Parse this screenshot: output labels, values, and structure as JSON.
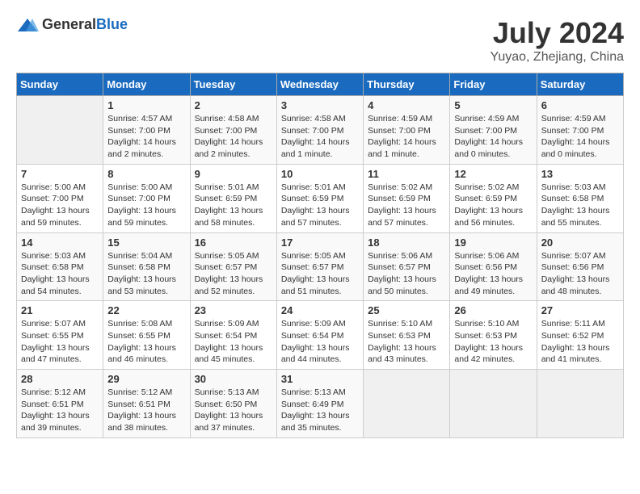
{
  "header": {
    "logo_general": "General",
    "logo_blue": "Blue",
    "title": "July 2024",
    "subtitle": "Yuyao, Zhejiang, China"
  },
  "calendar": {
    "columns": [
      "Sunday",
      "Monday",
      "Tuesday",
      "Wednesday",
      "Thursday",
      "Friday",
      "Saturday"
    ],
    "weeks": [
      [
        {
          "day": "",
          "info": ""
        },
        {
          "day": "1",
          "info": "Sunrise: 4:57 AM\nSunset: 7:00 PM\nDaylight: 14 hours\nand 2 minutes."
        },
        {
          "day": "2",
          "info": "Sunrise: 4:58 AM\nSunset: 7:00 PM\nDaylight: 14 hours\nand 2 minutes."
        },
        {
          "day": "3",
          "info": "Sunrise: 4:58 AM\nSunset: 7:00 PM\nDaylight: 14 hours\nand 1 minute."
        },
        {
          "day": "4",
          "info": "Sunrise: 4:59 AM\nSunset: 7:00 PM\nDaylight: 14 hours\nand 1 minute."
        },
        {
          "day": "5",
          "info": "Sunrise: 4:59 AM\nSunset: 7:00 PM\nDaylight: 14 hours\nand 0 minutes."
        },
        {
          "day": "6",
          "info": "Sunrise: 4:59 AM\nSunset: 7:00 PM\nDaylight: 14 hours\nand 0 minutes."
        }
      ],
      [
        {
          "day": "7",
          "info": "Sunrise: 5:00 AM\nSunset: 7:00 PM\nDaylight: 13 hours\nand 59 minutes."
        },
        {
          "day": "8",
          "info": "Sunrise: 5:00 AM\nSunset: 7:00 PM\nDaylight: 13 hours\nand 59 minutes."
        },
        {
          "day": "9",
          "info": "Sunrise: 5:01 AM\nSunset: 6:59 PM\nDaylight: 13 hours\nand 58 minutes."
        },
        {
          "day": "10",
          "info": "Sunrise: 5:01 AM\nSunset: 6:59 PM\nDaylight: 13 hours\nand 57 minutes."
        },
        {
          "day": "11",
          "info": "Sunrise: 5:02 AM\nSunset: 6:59 PM\nDaylight: 13 hours\nand 57 minutes."
        },
        {
          "day": "12",
          "info": "Sunrise: 5:02 AM\nSunset: 6:59 PM\nDaylight: 13 hours\nand 56 minutes."
        },
        {
          "day": "13",
          "info": "Sunrise: 5:03 AM\nSunset: 6:58 PM\nDaylight: 13 hours\nand 55 minutes."
        }
      ],
      [
        {
          "day": "14",
          "info": "Sunrise: 5:03 AM\nSunset: 6:58 PM\nDaylight: 13 hours\nand 54 minutes."
        },
        {
          "day": "15",
          "info": "Sunrise: 5:04 AM\nSunset: 6:58 PM\nDaylight: 13 hours\nand 53 minutes."
        },
        {
          "day": "16",
          "info": "Sunrise: 5:05 AM\nSunset: 6:57 PM\nDaylight: 13 hours\nand 52 minutes."
        },
        {
          "day": "17",
          "info": "Sunrise: 5:05 AM\nSunset: 6:57 PM\nDaylight: 13 hours\nand 51 minutes."
        },
        {
          "day": "18",
          "info": "Sunrise: 5:06 AM\nSunset: 6:57 PM\nDaylight: 13 hours\nand 50 minutes."
        },
        {
          "day": "19",
          "info": "Sunrise: 5:06 AM\nSunset: 6:56 PM\nDaylight: 13 hours\nand 49 minutes."
        },
        {
          "day": "20",
          "info": "Sunrise: 5:07 AM\nSunset: 6:56 PM\nDaylight: 13 hours\nand 48 minutes."
        }
      ],
      [
        {
          "day": "21",
          "info": "Sunrise: 5:07 AM\nSunset: 6:55 PM\nDaylight: 13 hours\nand 47 minutes."
        },
        {
          "day": "22",
          "info": "Sunrise: 5:08 AM\nSunset: 6:55 PM\nDaylight: 13 hours\nand 46 minutes."
        },
        {
          "day": "23",
          "info": "Sunrise: 5:09 AM\nSunset: 6:54 PM\nDaylight: 13 hours\nand 45 minutes."
        },
        {
          "day": "24",
          "info": "Sunrise: 5:09 AM\nSunset: 6:54 PM\nDaylight: 13 hours\nand 44 minutes."
        },
        {
          "day": "25",
          "info": "Sunrise: 5:10 AM\nSunset: 6:53 PM\nDaylight: 13 hours\nand 43 minutes."
        },
        {
          "day": "26",
          "info": "Sunrise: 5:10 AM\nSunset: 6:53 PM\nDaylight: 13 hours\nand 42 minutes."
        },
        {
          "day": "27",
          "info": "Sunrise: 5:11 AM\nSunset: 6:52 PM\nDaylight: 13 hours\nand 41 minutes."
        }
      ],
      [
        {
          "day": "28",
          "info": "Sunrise: 5:12 AM\nSunset: 6:51 PM\nDaylight: 13 hours\nand 39 minutes."
        },
        {
          "day": "29",
          "info": "Sunrise: 5:12 AM\nSunset: 6:51 PM\nDaylight: 13 hours\nand 38 minutes."
        },
        {
          "day": "30",
          "info": "Sunrise: 5:13 AM\nSunset: 6:50 PM\nDaylight: 13 hours\nand 37 minutes."
        },
        {
          "day": "31",
          "info": "Sunrise: 5:13 AM\nSunset: 6:49 PM\nDaylight: 13 hours\nand 35 minutes."
        },
        {
          "day": "",
          "info": ""
        },
        {
          "day": "",
          "info": ""
        },
        {
          "day": "",
          "info": ""
        }
      ]
    ]
  }
}
